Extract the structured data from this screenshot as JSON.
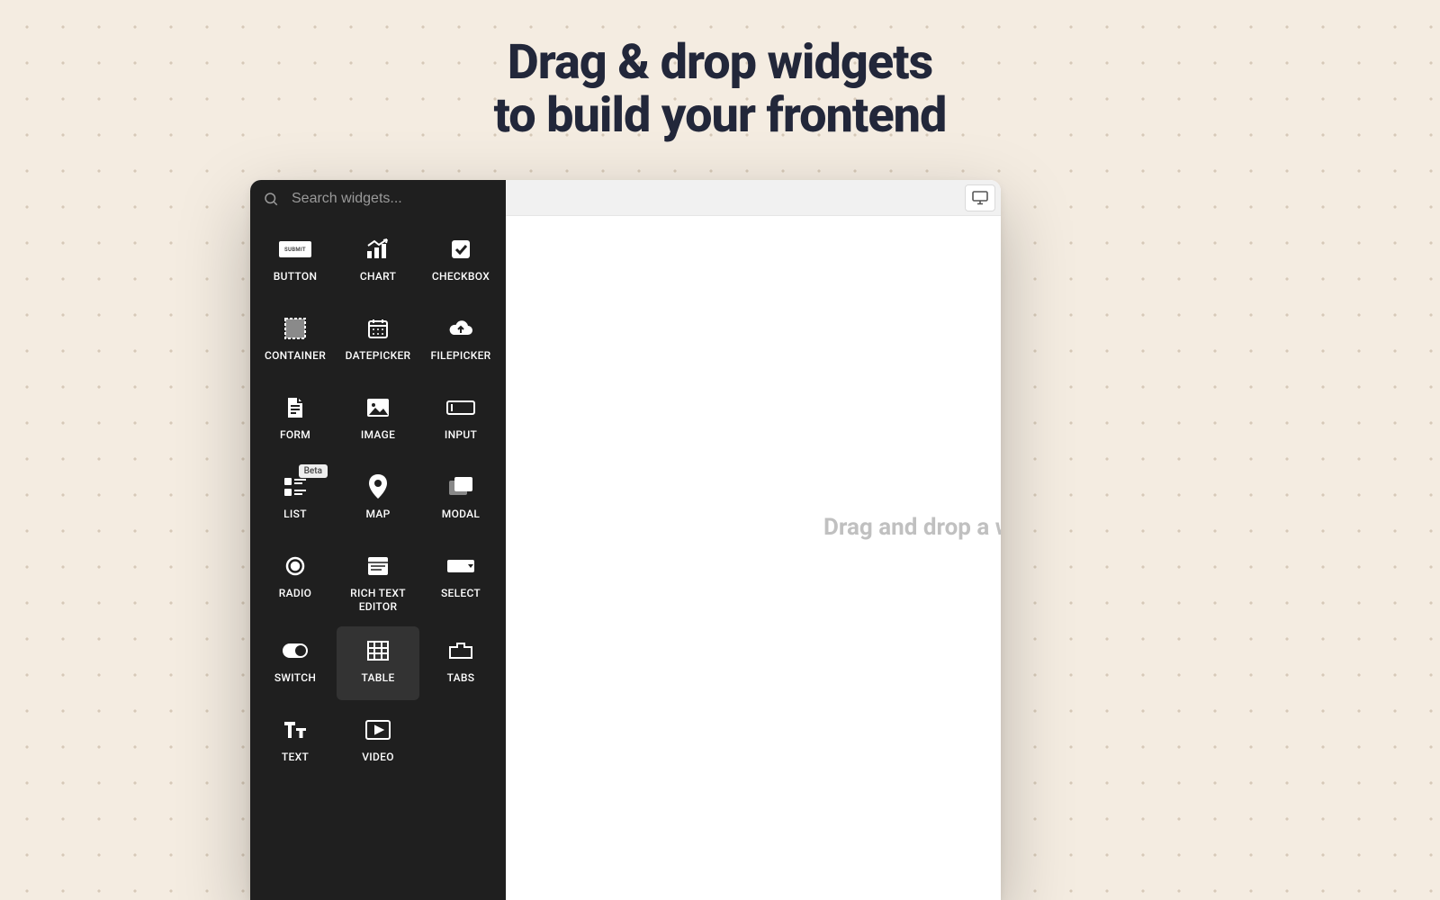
{
  "headline_line1": "Drag & drop widgets",
  "headline_line2": "to build your frontend",
  "search": {
    "placeholder": "Search widgets..."
  },
  "canvas": {
    "hint": "Drag and drop a w"
  },
  "widgets": {
    "button": {
      "label": "BUTTON",
      "pill": "SUBMIT"
    },
    "chart": {
      "label": "CHART"
    },
    "checkbox": {
      "label": "CHECKBOX"
    },
    "container": {
      "label": "CONTAINER"
    },
    "datepicker": {
      "label": "DATEPICKER"
    },
    "filepicker": {
      "label": "FILEPICKER"
    },
    "form": {
      "label": "FORM"
    },
    "image": {
      "label": "IMAGE"
    },
    "input": {
      "label": "INPUT"
    },
    "list": {
      "label": "LIST",
      "badge": "Beta"
    },
    "map": {
      "label": "MAP"
    },
    "modal": {
      "label": "MODAL"
    },
    "radio": {
      "label": "RADIO"
    },
    "rte": {
      "label": "RICH TEXT EDITOR"
    },
    "select": {
      "label": "SELECT"
    },
    "switch": {
      "label": "SWITCH"
    },
    "table": {
      "label": "TABLE"
    },
    "tabs": {
      "label": "TABS"
    },
    "text": {
      "label": "TEXT"
    },
    "video": {
      "label": "VIDEO"
    }
  }
}
